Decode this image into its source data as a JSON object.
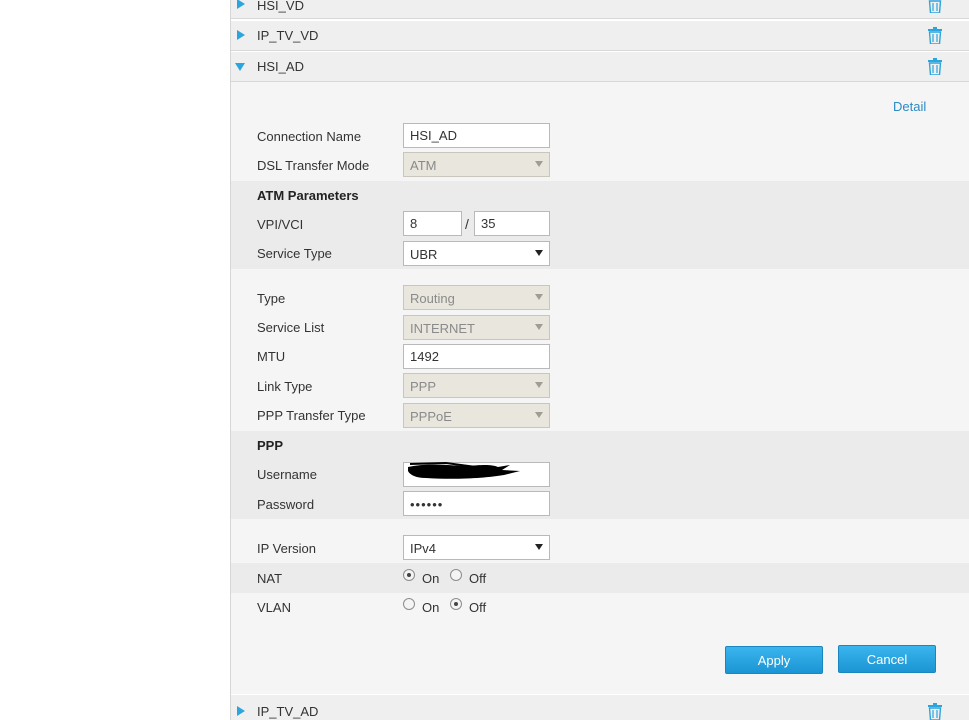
{
  "accordion": {
    "items": [
      {
        "label": "HSI_VD",
        "expanded": false
      },
      {
        "label": "IP_TV_VD",
        "expanded": false
      },
      {
        "label": "HSI_AD",
        "expanded": true
      },
      {
        "label": "IP_TV_AD",
        "expanded": false
      }
    ]
  },
  "detail_link": "Detail",
  "form": {
    "connection_name": {
      "label": "Connection Name",
      "value": "HSI_AD"
    },
    "dsl_transfer_mode": {
      "label": "DSL Transfer Mode",
      "value": "ATM"
    },
    "atm_section": "ATM Parameters",
    "vpi_vci": {
      "label": "VPI/VCI",
      "vpi": "8",
      "separator": "/",
      "vci": "35"
    },
    "service_type": {
      "label": "Service Type",
      "value": "UBR"
    },
    "type": {
      "label": "Type",
      "value": "Routing"
    },
    "service_list": {
      "label": "Service List",
      "value": "INTERNET"
    },
    "mtu": {
      "label": "MTU",
      "value": "1492"
    },
    "link_type": {
      "label": "Link Type",
      "value": "PPP"
    },
    "ppp_transfer_type": {
      "label": "PPP Transfer Type",
      "value": "PPPoE"
    },
    "ppp_section": "PPP",
    "username": {
      "label": "Username"
    },
    "password": {
      "label": "Password",
      "value": "••••••"
    },
    "ip_version": {
      "label": "IP Version",
      "value": "IPv4"
    },
    "nat": {
      "label": "NAT",
      "on": "On",
      "off": "Off",
      "selected": "On"
    },
    "vlan": {
      "label": "VLAN",
      "on": "On",
      "off": "Off",
      "selected": "Off"
    }
  },
  "buttons": {
    "apply": "Apply",
    "cancel": "Cancel"
  },
  "colors": {
    "accent": "#2ba5dd",
    "button": "#2aa3e0",
    "link": "#2b8bc3"
  }
}
